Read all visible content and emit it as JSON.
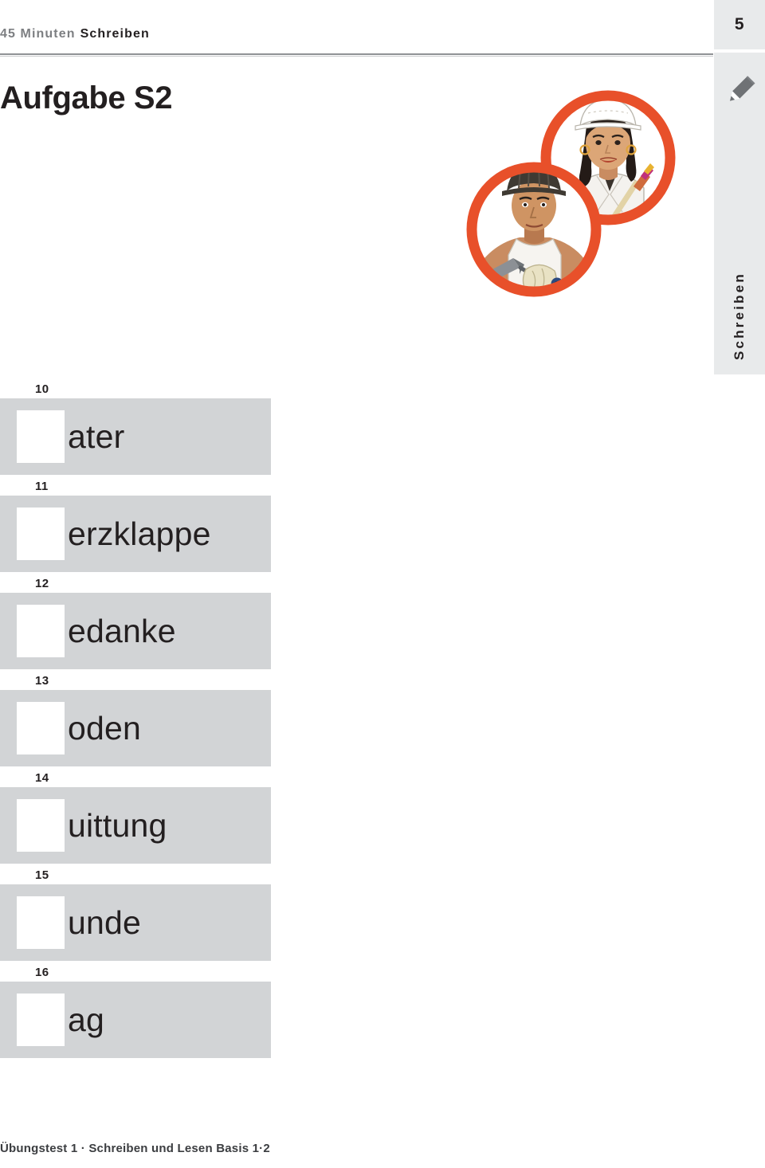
{
  "header": {
    "duration_label": "45 Minuten",
    "skill_label": "Schreiben"
  },
  "sidebar": {
    "page_number": "5",
    "vertical_label": "Schreiben",
    "pencil_icon": "pencil-icon",
    "accent_gray": "#e8eaeb"
  },
  "title": "Aufgabe S2",
  "illustration": {
    "alt_label": "Zwei Handwerker in orangefarbenen Kreisen",
    "ring_color": "#e8502a",
    "figures": [
      {
        "name": "painter-woman",
        "helmet": "white",
        "tool": "paint-brush"
      },
      {
        "name": "construction-man",
        "helmet": "dark-gray",
        "tool": "trowel"
      }
    ]
  },
  "exercises": [
    {
      "number": "10",
      "fragment": "ater"
    },
    {
      "number": "11",
      "fragment": "erzklappe"
    },
    {
      "number": "12",
      "fragment": "edanke"
    },
    {
      "number": "13",
      "fragment": "oden"
    },
    {
      "number": "14",
      "fragment": "uittung"
    },
    {
      "number": "15",
      "fragment": "unde"
    },
    {
      "number": "16",
      "fragment": "ag"
    }
  ],
  "colors": {
    "bar_gray": "#d2d4d6",
    "blank_white": "#ffffff",
    "text_dark": "#231f20",
    "rule_gray": "#8f9295"
  },
  "footer": "Übungstest 1 · Schreiben und Lesen Basis 1·2"
}
